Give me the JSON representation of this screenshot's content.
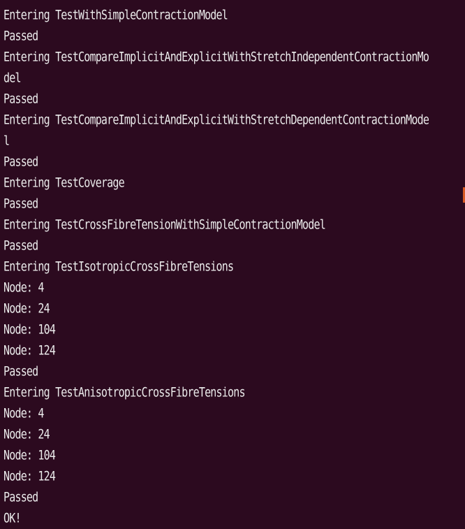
{
  "terminal": {
    "background": "#2c0a1f",
    "foreground": "#ebebeb",
    "accent": "#d75a24",
    "lines": [
      "Entering TestWithSimpleContractionModel",
      "Passed",
      "Entering TestCompareImplicitAndExplicitWithStretchIndependentContractionMo",
      "del",
      "Passed",
      "Entering TestCompareImplicitAndExplicitWithStretchDependentContractionMode",
      "l",
      "Passed",
      "Entering TestCoverage",
      "Passed",
      "Entering TestCrossFibreTensionWithSimpleContractionModel",
      "Passed",
      "Entering TestIsotropicCrossFibreTensions",
      "Node: 4",
      "Node: 24",
      "Node: 104",
      "Node: 124",
      "Passed",
      "Entering TestAnisotropicCrossFibreTensions",
      "Node: 4",
      "Node: 24",
      "Node: 104",
      "Node: 124",
      "Passed",
      "OK!"
    ]
  }
}
